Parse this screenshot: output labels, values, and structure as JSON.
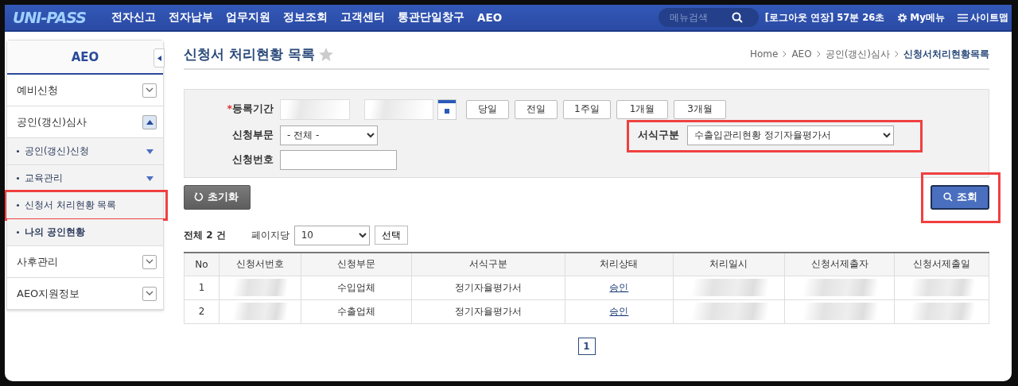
{
  "header": {
    "logo": "UNI-PASS",
    "nav": [
      "전자신고",
      "전자납부",
      "업무지원",
      "정보조회",
      "고객센터",
      "통관단일창구",
      "AEO"
    ],
    "search": {
      "placeholder": "메뉴검색"
    },
    "session": "[로그아웃 연장] 57분 26초",
    "my_menu": "My메뉴",
    "sitemap": "사이트맵"
  },
  "sidebar": {
    "title": "AEO",
    "items": [
      {
        "label": "예비신청",
        "expanded": false
      },
      {
        "label": "공인(갱신)심사",
        "expanded": true,
        "children": [
          {
            "label": "공인(갱신)신청",
            "has_submenu": true,
            "emphasized": false,
            "highlighted": false
          },
          {
            "label": "교육관리",
            "has_submenu": true,
            "emphasized": false,
            "highlighted": false
          },
          {
            "label": "신청서 처리현황 목록",
            "has_submenu": false,
            "emphasized": false,
            "highlighted": true
          },
          {
            "label": "나의 공인현황",
            "has_submenu": false,
            "emphasized": true,
            "highlighted": false
          }
        ]
      },
      {
        "label": "사후관리",
        "expanded": false
      },
      {
        "label": "AEO지원정보",
        "expanded": false
      }
    ]
  },
  "page": {
    "title": "신청서 처리현황 목록",
    "favorite": false,
    "breadcrumb": [
      "Home",
      "AEO",
      "공인(갱신)심사",
      "신청서처리현황목록"
    ]
  },
  "filters": {
    "period": {
      "required_mark": "*",
      "label": "등록기간",
      "quick_buttons": [
        "당일",
        "전일",
        "1주일",
        "1개월",
        "3개월"
      ]
    },
    "department": {
      "label": "신청부문",
      "value": "- 전체 -"
    },
    "form_type": {
      "label": "서식구분",
      "value": "수출입관리현황 정기자율평가서",
      "highlighted": true
    },
    "application_no": {
      "label": "신청번호"
    }
  },
  "actions": {
    "reset": "초기화",
    "search": {
      "label": "조회",
      "highlighted": true
    }
  },
  "summary": {
    "total_label": "전체",
    "total": "2",
    "unit": "건",
    "per_page_label": "페이지당",
    "per_page": "10",
    "apply": "선택"
  },
  "table": {
    "columns": [
      "No",
      "신청서번호",
      "신청부문",
      "서식구분",
      "처리상태",
      "처리일시",
      "신청서제출자",
      "신청서제출일"
    ],
    "rows": [
      [
        {
          "kind": "text",
          "text": "1"
        },
        {
          "kind": "redacted"
        },
        {
          "kind": "text",
          "text": "수입업체"
        },
        {
          "kind": "text",
          "text": "정기자율평가서"
        },
        {
          "kind": "link",
          "text": "승인"
        },
        {
          "kind": "redacted"
        },
        {
          "kind": "redacted"
        },
        {
          "kind": "redacted"
        }
      ],
      [
        {
          "kind": "text",
          "text": "2"
        },
        {
          "kind": "redacted"
        },
        {
          "kind": "text",
          "text": "수출업체"
        },
        {
          "kind": "text",
          "text": "정기자율평가서"
        },
        {
          "kind": "link",
          "text": "승인"
        },
        {
          "kind": "redacted"
        },
        {
          "kind": "redacted"
        },
        {
          "kind": "redacted"
        }
      ]
    ]
  },
  "pagination": [
    {
      "label": "1",
      "selected": true
    }
  ]
}
